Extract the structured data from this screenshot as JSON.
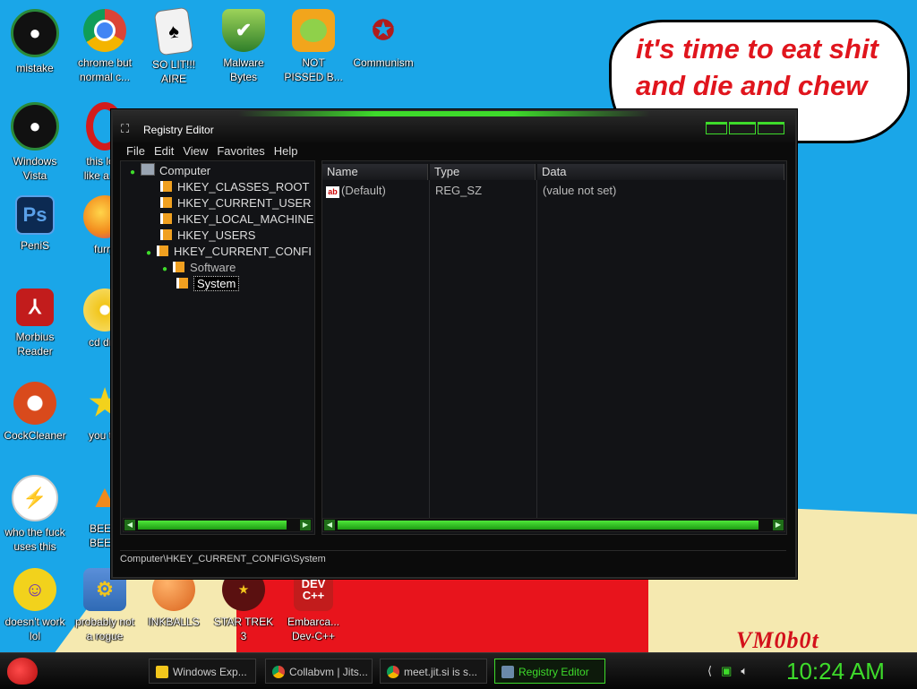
{
  "wallpaper": {
    "speech_text": "it's time to eat shit and die and chew",
    "signature": "VM0b0t"
  },
  "desktop_icons": [
    {
      "label": "mistake",
      "icon": "green-orb-icon",
      "color": "#1a7a2e"
    },
    {
      "label": "chrome but\nnormal c...",
      "icon": "chrome-icon",
      "color": "#e8b21c"
    },
    {
      "label": "SO LIT!!!\nAIRE",
      "icon": "playing-card-icon",
      "color": "#e9e9e9"
    },
    {
      "label": "Malware\nBytes",
      "icon": "shield-check-icon",
      "color": "#8bc34a"
    },
    {
      "label": "NOT\nPISSED B...",
      "icon": "angry-pig-icon",
      "color": "#f3a21c"
    },
    {
      "label": "Communism",
      "icon": "red-star-emblem-icon",
      "color": "#b01c1c"
    },
    {
      "label": "Windows\nVista",
      "icon": "green-orb-icon",
      "color": "#1a7a2e"
    },
    {
      "label": "this lo...\nlike a v...",
      "icon": "opera-icon",
      "color": "#d31c1c"
    },
    {
      "label": "PeniS",
      "icon": "photoshop-icon",
      "color": "#1b5fa8"
    },
    {
      "label": "furry",
      "icon": "firefox-icon",
      "color": "#f28a1c"
    },
    {
      "label": "Morbius\nReader",
      "icon": "pdf-reader-icon",
      "color": "#c21c1c"
    },
    {
      "label": "cd dr...",
      "icon": "cd-drive-icon",
      "color": "#f2c61c"
    },
    {
      "label": "CockCleaner",
      "icon": "ccleaner-icon",
      "color": "#d94a1c"
    },
    {
      "label": "you t...",
      "icon": "star-icon",
      "color": "#f2d21c"
    },
    {
      "label": "who the fuck\nuses this",
      "icon": "bolt-icon",
      "color": "#f25a1c"
    },
    {
      "label": "BEE...\nBEE...",
      "icon": "vlc-cone-icon",
      "color": "#f28a1c"
    },
    {
      "label": "doesn't work\nlol",
      "icon": "yahoo-messenger-icon",
      "color": "#6a2fb5"
    },
    {
      "label": "probably not\na rogue",
      "icon": "gears-computer-icon",
      "color": "#2f6ab5"
    },
    {
      "label": "INKBALLS",
      "icon": "inkball-icon",
      "color": "#d9621c"
    },
    {
      "label": "STAR TREK\n3",
      "icon": "star-wars-icon",
      "color": "#8a1c1c"
    },
    {
      "label": "Embarca...\nDev-C++",
      "icon": "devcpp-icon",
      "color": "#c21c1c"
    }
  ],
  "registry_window": {
    "title": "Registry Editor",
    "menu": [
      "File",
      "Edit",
      "View",
      "Favorites",
      "Help"
    ],
    "tree": {
      "root": "Computer",
      "keys": [
        "HKEY_CLASSES_ROOT",
        "HKEY_CURRENT_USER",
        "HKEY_LOCAL_MACHINE",
        "HKEY_USERS",
        "HKEY_CURRENT_CONFI"
      ],
      "subkeys": [
        "Software",
        "System"
      ],
      "selected": "System"
    },
    "columns": [
      "Name",
      "Type",
      "Data"
    ],
    "rows": [
      {
        "name": "(Default)",
        "type": "REG_SZ",
        "data": "(value not set)"
      }
    ],
    "status_path": "Computer\\HKEY_CURRENT_CONFIG\\System"
  },
  "taskbar": {
    "tasks": [
      {
        "label": "Windows Exp...",
        "icon": "folder-icon",
        "color": "#f2c61c",
        "active": false
      },
      {
        "label": "Collabvm | Jits...",
        "icon": "chrome-icon",
        "color": "#e8b21c",
        "active": false
      },
      {
        "label": "meet.jit.si is s...",
        "icon": "chrome-icon",
        "color": "#e8b21c",
        "active": false
      },
      {
        "label": "Registry Editor",
        "icon": "regedit-icon",
        "color": "#3edb2b",
        "active": true
      }
    ],
    "clock": "10:24 AM",
    "accent_color": "#3edb2b"
  }
}
